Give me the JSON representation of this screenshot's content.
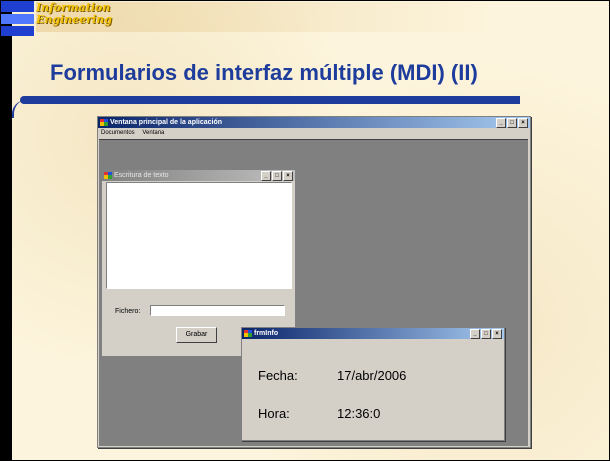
{
  "slide": {
    "logo_line1": "Information",
    "logo_line2": "Engineering",
    "title": "Formularios de interfaz múltiple (MDI) (II)"
  },
  "main_window": {
    "title": "Ventana principal de la aplicación",
    "menu": [
      "Documentos",
      "Ventana"
    ]
  },
  "child_escritura": {
    "title": "Escritura de texto",
    "fichero_label": "Fichero:",
    "fichero_value": "",
    "grabar_label": "Grabar"
  },
  "child_info": {
    "title": "frmInfo",
    "fecha_label": "Fecha:",
    "fecha_value": "17/abr/2006",
    "hora_label": "Hora:",
    "hora_value": "12:36:0"
  },
  "window_buttons": {
    "minimize": "_",
    "maximize": "□",
    "close": "×"
  },
  "colors": {
    "title_blue": "#1d3c9c",
    "active_titlebar": "#0a246a",
    "window_face": "#d4d0c8",
    "mdi_client": "#808080"
  }
}
